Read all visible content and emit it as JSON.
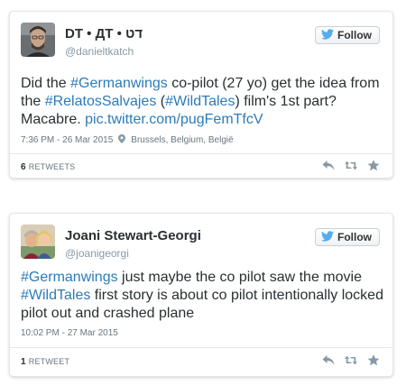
{
  "tweets": [
    {
      "name": "DT • ДТ • דט",
      "handle": "@danieltkatch",
      "follow_label": "Follow",
      "text": {
        "part1": "Did the ",
        "hashtag1": "#Germanwings",
        "part2": " co-pilot (27 yo) get the idea from the ",
        "hashtag2": "#RelatosSalvajes",
        "part3": " (",
        "hashtag3": "#WildTales",
        "part4": ") film's 1st part? Macabre. ",
        "link": "pic.twitter.com/pugFemTfcV"
      },
      "timestamp": "7:36 PM - 26 Mar 2015",
      "location": "Brussels, Belgium, België",
      "stat_count": "6",
      "stat_label": "RETWEETS"
    },
    {
      "name": "Joani Stewart-Georgi",
      "handle": "@joanigeorgi",
      "follow_label": "Follow",
      "text": {
        "hashtag1": "#Germanwings",
        "part1": " just maybe the co pilot saw the movie ",
        "hashtag2": "#WildTales",
        "part2": " first story is about co pilot intentionally locked pilot out and crashed plane"
      },
      "timestamp": "10:02 PM - 27 Mar 2015",
      "stat_count": "1",
      "stat_label": "RETWEET"
    }
  ],
  "icons": {
    "follow": "twitter-bird-icon",
    "location": "location-pin-icon",
    "reply": "reply-icon",
    "retweet": "retweet-icon",
    "favorite": "star-icon"
  },
  "colors": {
    "link": "#2b7bb9",
    "muted": "#66757f",
    "twitter_blue": "#55acee",
    "action_gray": "#8899a6"
  }
}
